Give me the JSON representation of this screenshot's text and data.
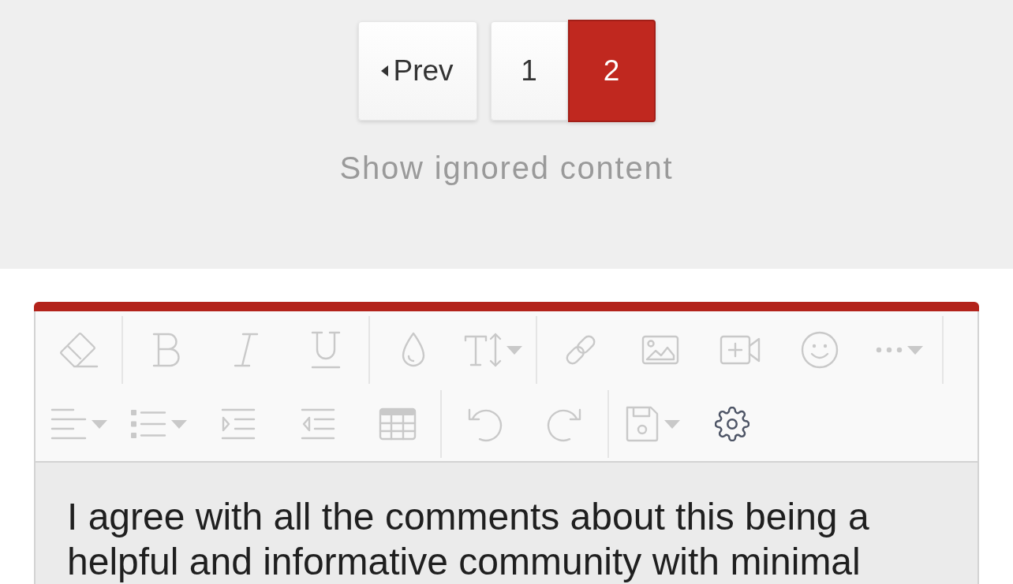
{
  "pagination": {
    "prev": {
      "label": "Prev"
    },
    "pages": [
      {
        "label": "1",
        "selected": false
      },
      {
        "label": "2",
        "selected": true
      }
    ]
  },
  "ignored_link": {
    "label": "Show ignored content"
  },
  "editor": {
    "toolbar": {
      "rows": [
        {
          "groups": [
            {
              "tools": [
                {
                  "kind": "eraser",
                  "menu": false,
                  "disabled": true
                }
              ]
            },
            {
              "tools": [
                {
                  "kind": "bold",
                  "menu": false,
                  "disabled": true
                },
                {
                  "kind": "italic",
                  "menu": false,
                  "disabled": true
                },
                {
                  "kind": "underline",
                  "menu": false,
                  "disabled": true
                }
              ]
            },
            {
              "tools": [
                {
                  "kind": "color",
                  "menu": false,
                  "disabled": true
                },
                {
                  "kind": "size",
                  "menu": true,
                  "disabled": true
                }
              ]
            },
            {
              "tools": [
                {
                  "kind": "link",
                  "menu": false,
                  "disabled": true
                },
                {
                  "kind": "image",
                  "menu": false,
                  "disabled": true
                },
                {
                  "kind": "video",
                  "menu": false,
                  "disabled": true
                },
                {
                  "kind": "emoji",
                  "menu": false,
                  "disabled": true
                },
                {
                  "kind": "more",
                  "menu": true,
                  "disabled": true
                }
              ]
            }
          ]
        },
        {
          "groups": [
            {
              "tools": [
                {
                  "kind": "align",
                  "menu": true,
                  "disabled": true
                },
                {
                  "kind": "list",
                  "menu": true,
                  "disabled": true
                },
                {
                  "kind": "indent",
                  "menu": false,
                  "disabled": true
                },
                {
                  "kind": "outdent",
                  "menu": false,
                  "disabled": true
                },
                {
                  "kind": "table",
                  "menu": false,
                  "disabled": true
                }
              ]
            },
            {
              "tools": [
                {
                  "kind": "undo",
                  "menu": false,
                  "disabled": true
                },
                {
                  "kind": "redo",
                  "menu": false,
                  "disabled": true
                }
              ]
            },
            {
              "tools": [
                {
                  "kind": "save",
                  "menu": true,
                  "disabled": true
                },
                {
                  "kind": "settings",
                  "menu": false,
                  "disabled": false
                }
              ]
            }
          ]
        }
      ]
    },
    "text": "I agree with all the comments about this being a helpful and informative community with minimal"
  }
}
